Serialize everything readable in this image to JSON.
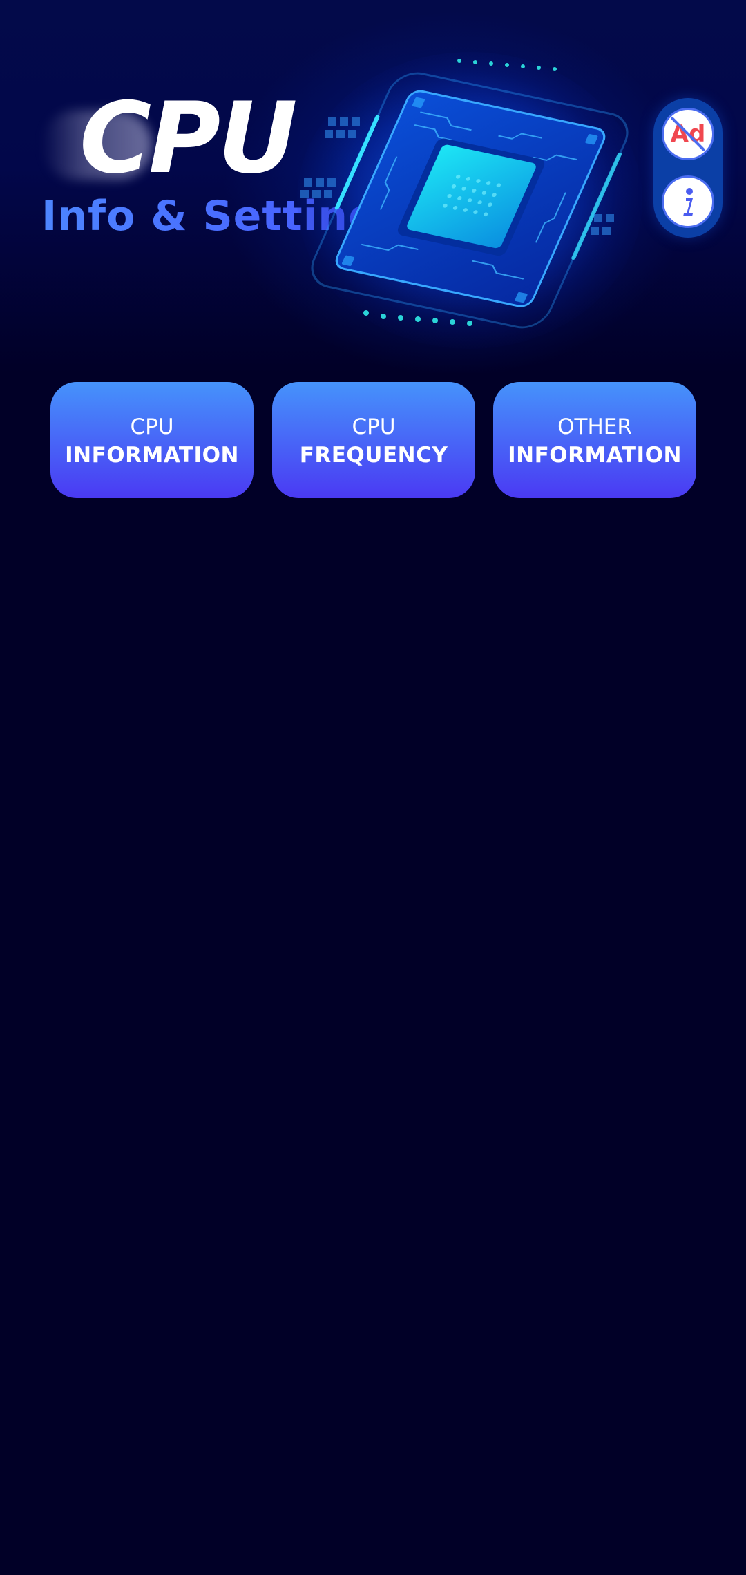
{
  "header": {
    "title": "CPU",
    "subtitle": "Info & Settings"
  },
  "side_actions": {
    "remove_ads_label": "Ad",
    "info_icon": "info-icon",
    "colors": {
      "panel": "#0b3fa6",
      "ad_text": "#f0474f",
      "strike": "#4a6cf0"
    }
  },
  "menu": {
    "buttons": [
      {
        "line1": "CPU",
        "line2": "INFORMATION"
      },
      {
        "line1": "CPU",
        "line2": "FREQUENCY"
      },
      {
        "line1": "OTHER",
        "line2": "INFORMATION"
      }
    ],
    "gradient": [
      "#4693fb",
      "#4a3af3"
    ]
  },
  "theme": {
    "background": "#010027",
    "accent": "#4d86ff"
  }
}
